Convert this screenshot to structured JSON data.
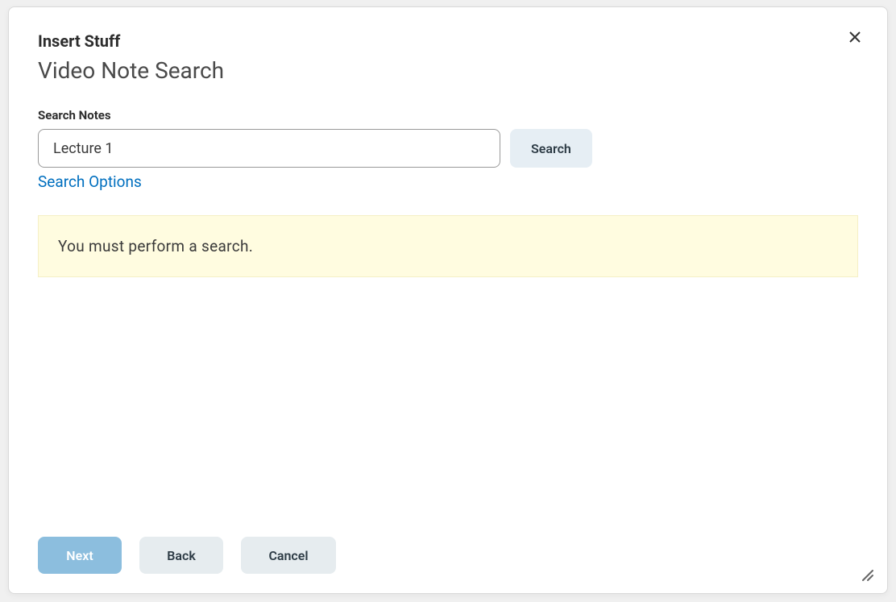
{
  "dialog": {
    "title": "Insert Stuff",
    "subtitle": "Video Note Search"
  },
  "search": {
    "label": "Search Notes",
    "value": "Lecture 1",
    "button_label": "Search",
    "options_link": "Search Options"
  },
  "alert": {
    "message": "You must perform a search."
  },
  "footer": {
    "next_label": "Next",
    "back_label": "Back",
    "cancel_label": "Cancel"
  }
}
